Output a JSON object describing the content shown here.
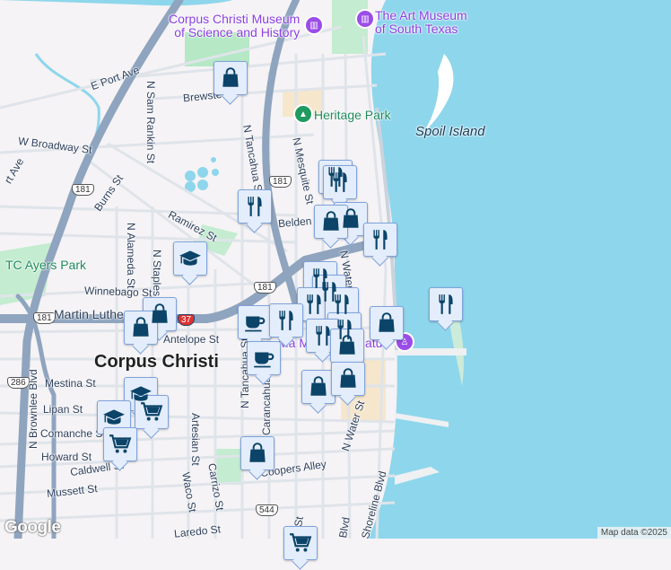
{
  "map": {
    "city": "Corpus Christi",
    "attribution": "Map data ©2025",
    "logo": "Google",
    "pois": [
      {
        "name": "Corpus Christi Museum\nof Science and History",
        "icon": "museum-icon"
      },
      {
        "name": "The Art Museum\nof South Texas",
        "icon": "museum-icon"
      },
      {
        "name": "Heritage Park",
        "icon": "park-icon"
      },
      {
        "name": "TC Ayers Park",
        "icon": "park-icon"
      },
      {
        "name": "Spoil Island",
        "icon": ""
      }
    ],
    "streets": [
      "E Port Ave",
      "Brewster",
      "N Sam Rankin St",
      "W Broadway St",
      "N Tancahua St",
      "N Mesquite St",
      "Burns St",
      "Ramirez St",
      "Belden St",
      "N Alameda St",
      "N Staples St",
      "Winnebago St",
      "Martin Luther",
      "Antelope St",
      "Mestina St",
      "Lipan St",
      "Comanche St",
      "Howard St",
      "Caldwell St",
      "Mussett St",
      "N Brownlee Blvd",
      "Artesian St",
      "Waco St",
      "Carrizo St",
      "N Tancahua St",
      "Carancahua St",
      "Coopers Alley",
      "N Water St",
      "N Water St",
      "Laredo St",
      "Shoreline Blvd",
      "Blvd",
      "al St",
      "rt Ave",
      "Ma M",
      "atue"
    ],
    "shields": [
      "181",
      "181",
      "181",
      "181",
      "286",
      "544",
      "37"
    ],
    "markers": [
      "shopping",
      "dining",
      "dining",
      "dining",
      "shopping",
      "dining",
      "education",
      "shopping",
      "shopping",
      "dining",
      "dining",
      "dining",
      "dining",
      "coffee",
      "dining",
      "dining",
      "shopping",
      "dining",
      "coffee",
      "shopping",
      "shopping",
      "shopping",
      "education",
      "education",
      "grocery",
      "grocery",
      "shopping",
      "grocery"
    ]
  }
}
